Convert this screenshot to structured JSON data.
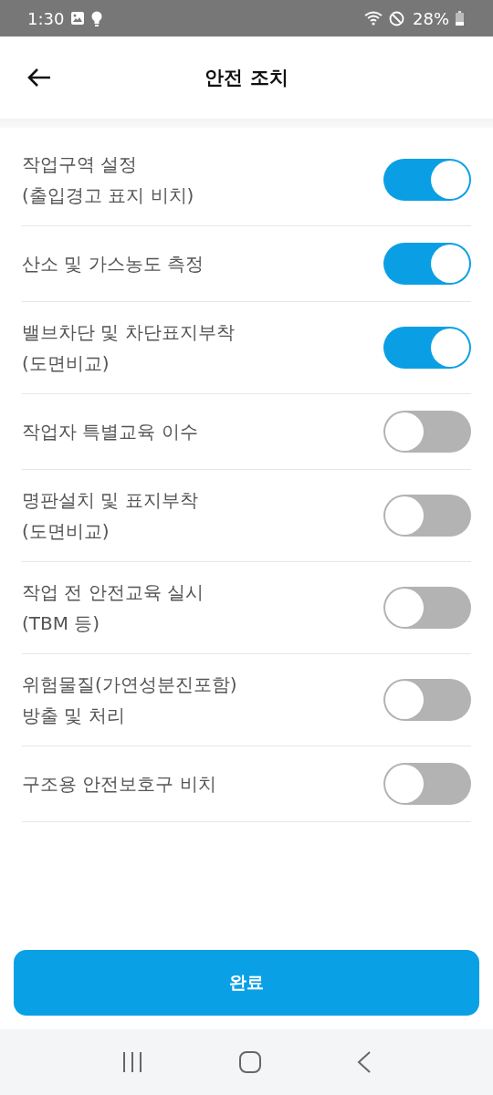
{
  "status_bar": {
    "time": "1:30",
    "battery": "28%"
  },
  "header": {
    "title": "안전 조치"
  },
  "items": [
    {
      "label": "작업구역 설정\n(출입경고 표지 비치)",
      "on": true
    },
    {
      "label": "산소 및 가스농도 측정",
      "on": true
    },
    {
      "label": "밸브차단 및 차단표지부착\n(도면비교)",
      "on": true
    },
    {
      "label": "작업자 특별교육 이수",
      "on": false
    },
    {
      "label": "명판설치 및 표지부착\n(도면비교)",
      "on": false
    },
    {
      "label": "작업 전 안전교육 실시\n(TBM 등)",
      "on": false
    },
    {
      "label": "위험물질(가연성분진포함)\n방출 및 처리",
      "on": false
    },
    {
      "label": "구조용 안전보호구 비치",
      "on": false
    }
  ],
  "done_button": "완료"
}
